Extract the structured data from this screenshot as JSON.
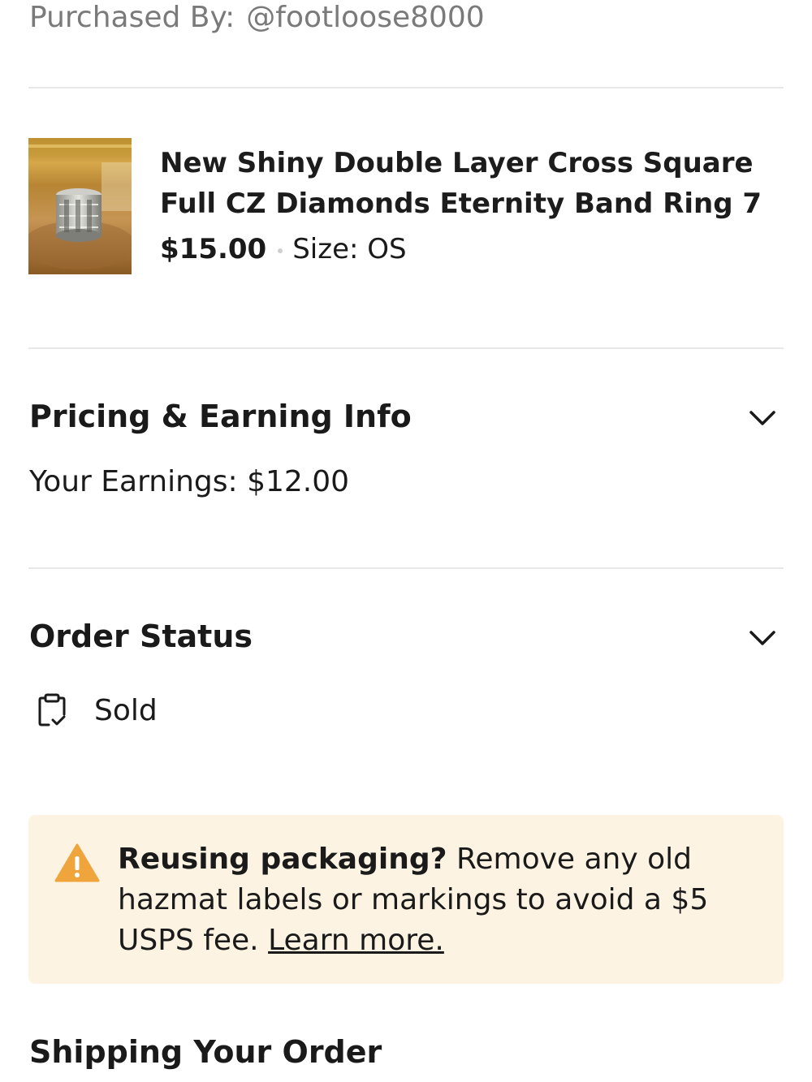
{
  "purchased": {
    "label": "Purchased By:",
    "handle": "@footloose8000"
  },
  "item": {
    "title": "New Shiny Double Layer Cross Square Full CZ Diamonds Eternity Band Ring 7",
    "price": "$15.00",
    "size_label": "Size:",
    "size_value": "OS",
    "image_icon": "ring-product-photo"
  },
  "pricing": {
    "title": "Pricing & Earning Info",
    "earnings_label": "Your Earnings:",
    "earnings_value": "$12.00",
    "expand_icon": "chevron-down-icon"
  },
  "order_status": {
    "title": "Order Status",
    "status": "Sold",
    "status_icon": "clipboard-check-icon",
    "expand_icon": "chevron-down-icon"
  },
  "notice": {
    "bold": "Reusing packaging?",
    "text": "Remove any old hazmat labels or markings to avoid a $5 USPS fee.",
    "link": "Learn more.",
    "icon": "warning-icon",
    "background": "#fcf3e2",
    "icon_color": "#f0a43c"
  },
  "shipping": {
    "title": "Shipping Your Order"
  }
}
